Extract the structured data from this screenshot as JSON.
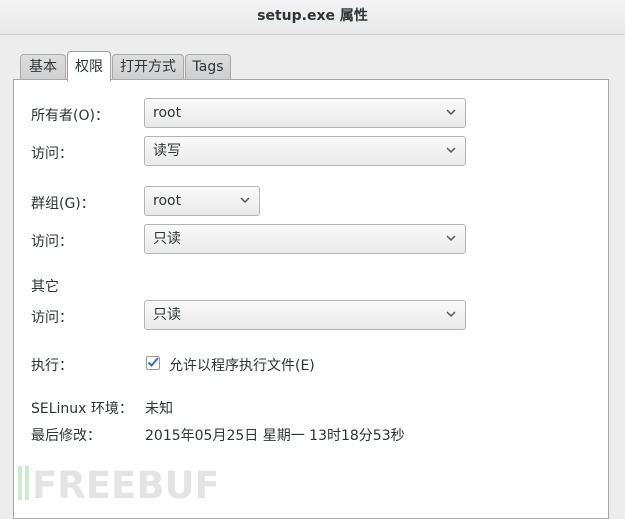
{
  "window": {
    "title": "setup.exe 属性"
  },
  "tabs": [
    {
      "label": "基本"
    },
    {
      "label": "权限"
    },
    {
      "label": "打开方式"
    },
    {
      "label": "Tags"
    }
  ],
  "permissions": {
    "owner_label": "所有者(O)：",
    "owner_value": "root",
    "owner_access_label": "访问：",
    "owner_access_value": "读写",
    "group_label": "群组(G)：",
    "group_value": "root",
    "group_access_label": "访问：",
    "group_access_value": "只读",
    "others_label": "其它",
    "others_access_label": "访问：",
    "others_access_value": "只读",
    "execute_label": "执行：",
    "execute_checkbox_label": "允许以程序执行文件(E)",
    "execute_checked": true,
    "selinux_label": "SELinux 环境：",
    "selinux_value": "未知",
    "modified_label": "最后修改：",
    "modified_value": "2015年05月25日 星期一 13时18分53秒"
  },
  "watermark": {
    "text": "FREEBUF"
  },
  "icons": {
    "dropdown": "chevron-down-icon",
    "check": "check-icon"
  },
  "colors": {
    "accent": "#4a90d9",
    "panel_bg": "#ffffff",
    "window_bg": "#ededed"
  }
}
